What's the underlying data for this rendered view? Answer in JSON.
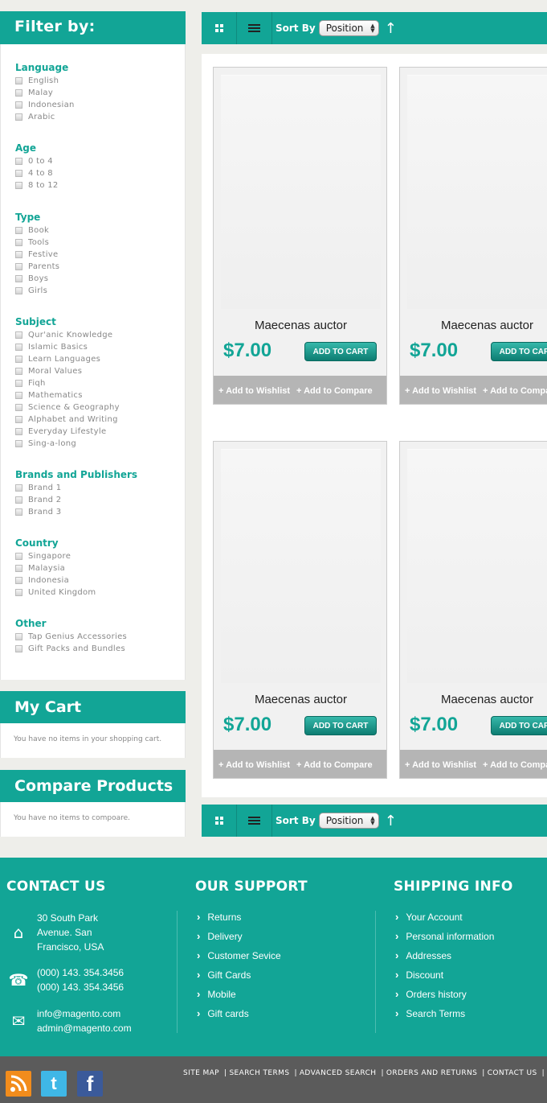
{
  "sidebar": {
    "filter_title": "Filter by:",
    "groups": [
      {
        "title": "Language",
        "items": [
          "English",
          "Malay",
          "Indonesian",
          "Arabic"
        ]
      },
      {
        "title": "Age",
        "items": [
          "0 to 4",
          "4 to 8",
          "8 to 12"
        ]
      },
      {
        "title": "Type",
        "items": [
          "Book",
          "Tools",
          "Festive",
          "Parents",
          "Boys",
          "Girls"
        ]
      },
      {
        "title": "Subject",
        "items": [
          "Qur'anic Knowledge",
          "Islamic Basics",
          "Learn Languages",
          "Moral Values",
          "Fiqh",
          "Mathematics",
          "Science & Geography",
          "Alphabet and Writing",
          "Everyday Lifestyle",
          "Sing-a-long"
        ]
      },
      {
        "title": "Brands and Publishers",
        "items": [
          "Brand 1",
          "Brand 2",
          "Brand 3"
        ]
      },
      {
        "title": "Country",
        "items": [
          "Singapore",
          "Malaysia",
          "Indonesia",
          "United Kingdom"
        ]
      },
      {
        "title": "Other",
        "items": [
          "Tap Genius Accessories",
          "Gift Packs and Bundles"
        ]
      }
    ],
    "cart": {
      "title": "My Cart",
      "empty": "You have no items in your shopping cart."
    },
    "compare": {
      "title": "Compare Products",
      "empty": "You have no items to compoare."
    }
  },
  "toolbar": {
    "sort_by": "Sort By",
    "sort_value": "Position"
  },
  "products": [
    {
      "name": "Maecenas auctor",
      "price": "$7.00",
      "add_to_cart": "ADD TO CART",
      "wishlist": "Add to Wishlist",
      "compare": "Add to Compare"
    },
    {
      "name": "Maecenas auctor",
      "price": "$7.00",
      "add_to_cart": "ADD TO CART",
      "wishlist": "Add to Wishlist",
      "compare": "Add to Compare"
    },
    {
      "name": "Maecenas auctor",
      "price": "$7.00",
      "add_to_cart": "ADD TO CART",
      "wishlist": "Add to Wishlist",
      "compare": "Add to Compare"
    },
    {
      "name": "Maecenas auctor",
      "price": "$7.00",
      "add_to_cart": "ADD TO CART",
      "wishlist": "Add to Wishlist",
      "compare": "Add to Compare"
    }
  ],
  "footer": {
    "contact": {
      "title": "CONTACT US",
      "address": "30 South Park Avenue. San Francisco, USA",
      "phone1": "(000) 143. 354.3456",
      "phone2": "(000) 143. 354.3456",
      "email1": "info@magento.com",
      "email2": "admin@magento.com"
    },
    "support": {
      "title": "OUR SUPPORT",
      "links": [
        "Returns",
        "Delivery",
        "Customer Sevice",
        "Gift Cards",
        "Mobile",
        "Gift cards"
      ]
    },
    "shipping": {
      "title": "SHIPPING INFO",
      "links": [
        "Your Account",
        "Personal information",
        "Addresses",
        "Discount",
        "Orders history",
        "Search Terms"
      ]
    },
    "bottom_links": [
      "SITE MAP",
      "SEARCH TERMS",
      "ADVANCED SEARCH",
      "ORDERS AND RETURNS",
      "CONTACT US"
    ],
    "social": [
      "rss-icon",
      "twitter-icon",
      "facebook-icon"
    ]
  },
  "colors": {
    "accent": "#12a596",
    "footer_bottom": "#5b5b5b"
  }
}
